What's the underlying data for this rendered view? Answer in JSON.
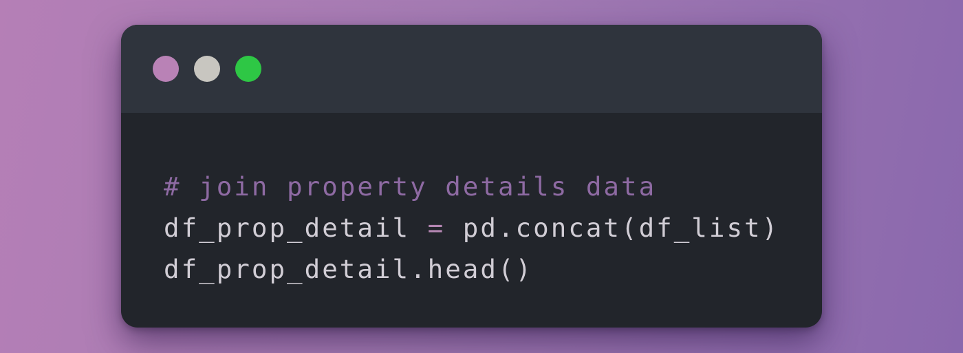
{
  "colors": {
    "close_dot": "#b982b6",
    "minimize_dot": "#c8c6c0",
    "zoom_dot": "#2ec745",
    "comment": "#8e6aa3",
    "code_text": "#d1cdd5",
    "operator": "#b486b2"
  },
  "code": {
    "comment_line": "# join property details data",
    "line2_lhs": "df_prop_detail ",
    "line2_op": "=",
    "line2_rhs": " pd.concat(df_list)",
    "line3": "df_prop_detail.head()"
  }
}
